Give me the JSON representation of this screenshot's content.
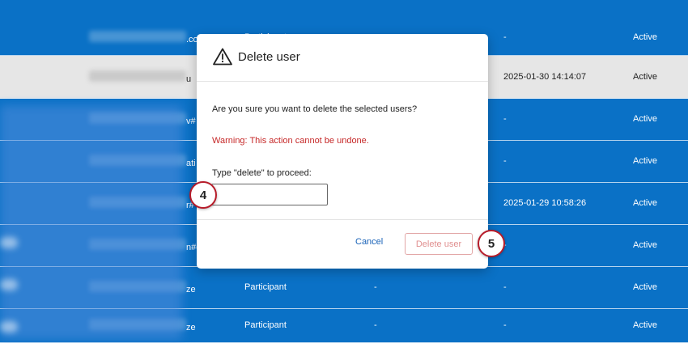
{
  "table": {
    "rows": [
      {
        "name_fragment": ".com#quniv",
        "role": "Participant",
        "dash": "",
        "last_login": "-",
        "status": "Active"
      },
      {
        "name_fragment": "u",
        "role": "",
        "dash": "",
        "last_login": "2025-01-30 14:14:07",
        "status": "Active",
        "highlight": true
      },
      {
        "name_fragment": "v#",
        "role": "",
        "dash": "",
        "last_login": "-",
        "status": "Active"
      },
      {
        "name_fragment": "ati",
        "role": "",
        "dash": "",
        "last_login": "-",
        "status": "Active"
      },
      {
        "name_fragment": "r#",
        "role": "",
        "dash": "",
        "last_login": "2025-01-29 10:58:26",
        "status": "Active"
      },
      {
        "name_fragment": "n#q",
        "role": "",
        "dash": "",
        "last_login": "-",
        "status": "Active"
      },
      {
        "name_fragment": "ze",
        "role": "Participant",
        "dash": "-",
        "last_login": "-",
        "status": "Active"
      },
      {
        "name_fragment": "ze",
        "role": "Participant",
        "dash": "-",
        "last_login": "-",
        "status": "Active"
      }
    ]
  },
  "modal": {
    "title": "Delete user",
    "title_icon": "warning-triangle-icon",
    "question": "Are you sure you want to delete the selected users?",
    "warning": "Warning: This action cannot be undone.",
    "warning_color": "#c62828",
    "prompt": "Type \"delete\" to proceed:",
    "input_value": "",
    "cancel_label": "Cancel",
    "delete_label": "Delete user"
  },
  "steps": {
    "input_step": "4",
    "delete_step": "5"
  },
  "colors": {
    "table_background": "#0a71c6",
    "highlight_row": "#e6e6e6",
    "step_ring": "#b71c2a",
    "link": "#1a63b8"
  }
}
